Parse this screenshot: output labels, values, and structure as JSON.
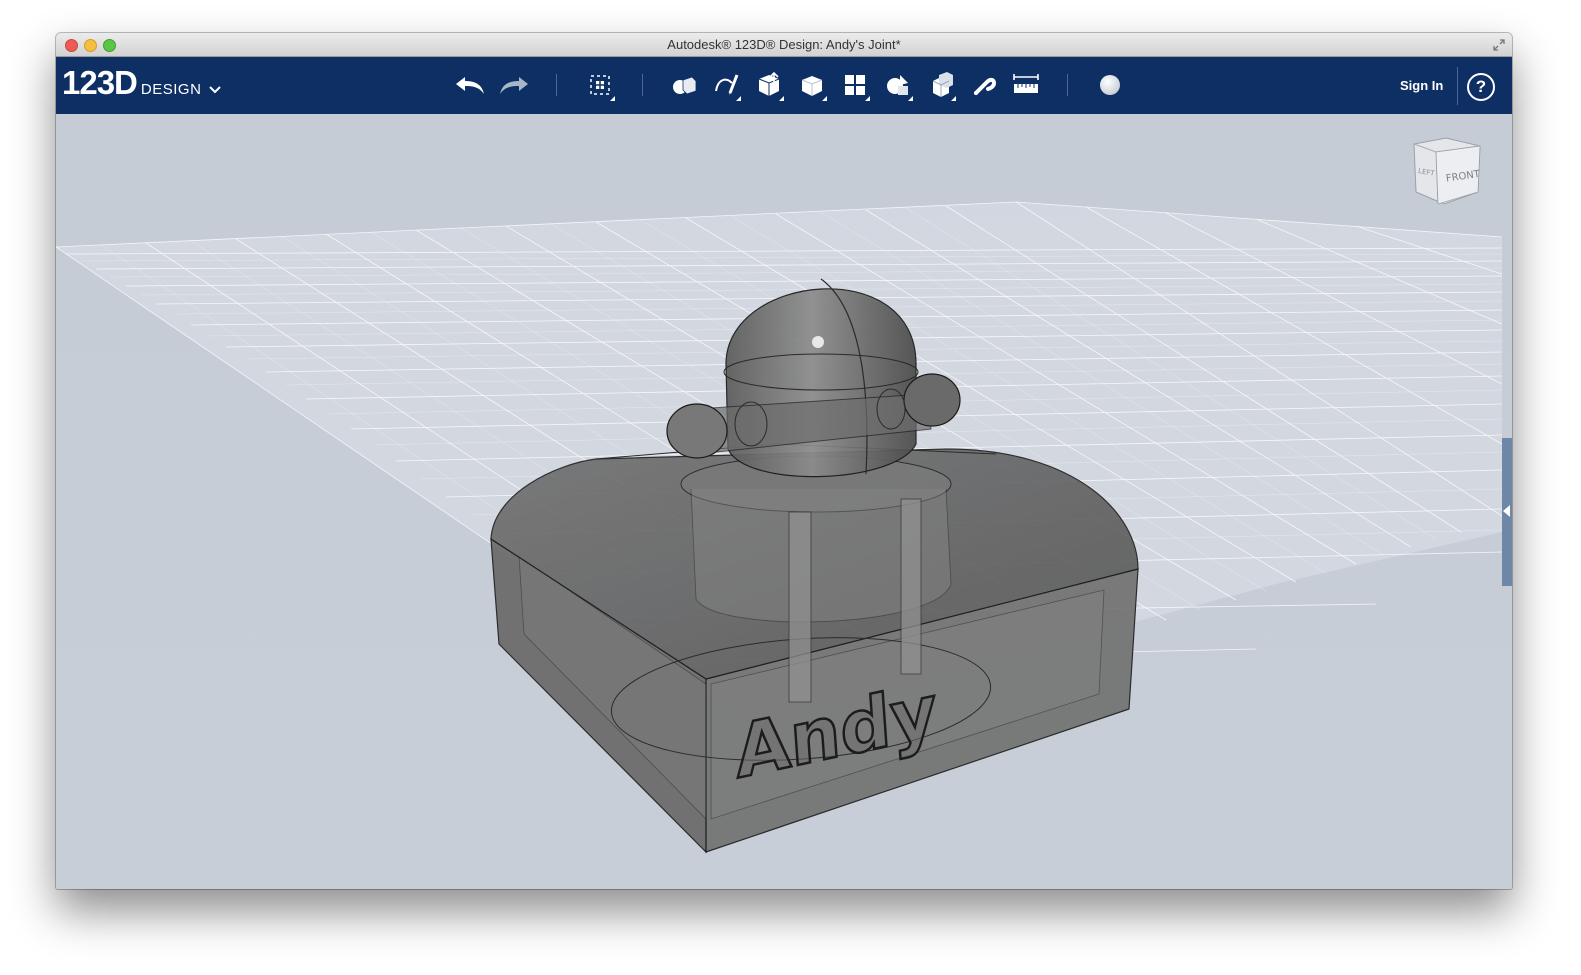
{
  "window": {
    "title": "Autodesk® 123D® Design: Andy's Joint*"
  },
  "app": {
    "logo_main": "123D",
    "logo_sub": "DESIGN"
  },
  "toolbar": {
    "tools": [
      "undo",
      "redo",
      "transform",
      "primitives",
      "sketch",
      "construct",
      "modify",
      "pattern",
      "group",
      "combine",
      "snap",
      "measure",
      "material"
    ],
    "sign_in_label": "Sign In",
    "help_label": "?"
  },
  "viewcube": {
    "front_label": "FRONT",
    "left_label": "LEFT"
  },
  "model": {
    "engraved_text": "Andy"
  },
  "colors": {
    "toolbar_bg": "#0e2f63",
    "viewport_bg": "#c7cdd6",
    "grid_line": "#ffffff",
    "model_fill": "#5a5a5a"
  }
}
